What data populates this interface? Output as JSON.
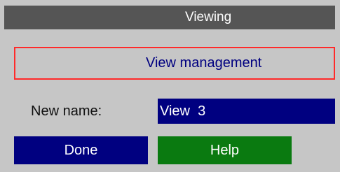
{
  "title_bar": {
    "title": "Viewing"
  },
  "view_management": {
    "label": "View management"
  },
  "new_name": {
    "label": "New name:",
    "value": "View  3"
  },
  "buttons": {
    "done": "Done",
    "help": "Help"
  },
  "colors": {
    "title_bg": "#555555",
    "panel_bg": "#c6c6c6",
    "accent_border": "#ff2a2a",
    "field_bg": "#000080",
    "done_bg": "#000080",
    "help_bg": "#0a7a10"
  }
}
